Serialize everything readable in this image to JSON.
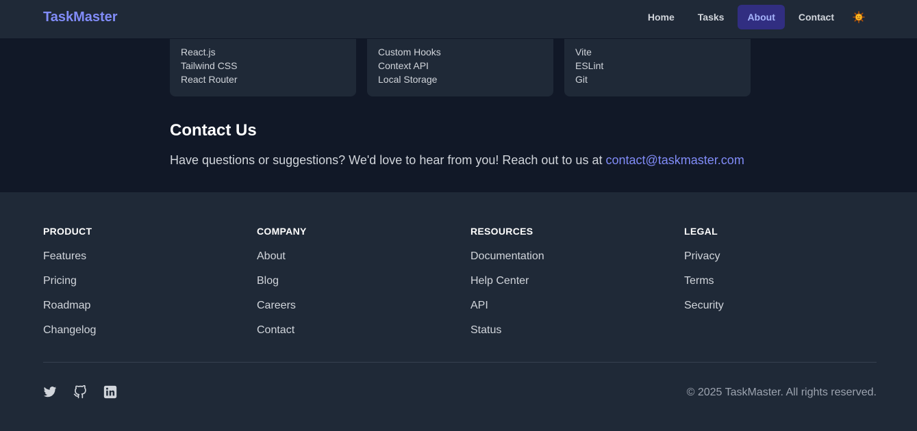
{
  "nav": {
    "brand": "TaskMaster",
    "links": [
      "Home",
      "Tasks",
      "About",
      "Contact"
    ],
    "active": "About",
    "theme_icon": "sun-emoji"
  },
  "tech": [
    {
      "items": [
        "React.js",
        "Tailwind CSS",
        "React Router"
      ]
    },
    {
      "items": [
        "Custom Hooks",
        "Context API",
        "Local Storage"
      ]
    },
    {
      "items": [
        "Vite",
        "ESLint",
        "Git"
      ]
    }
  ],
  "contact": {
    "title": "Contact Us",
    "text": "Have questions or suggestions? We'd love to hear from you! Reach out to us at ",
    "email": "contact@taskmaster.com"
  },
  "footer": {
    "columns": [
      {
        "heading": "PRODUCT",
        "links": [
          "Features",
          "Pricing",
          "Roadmap",
          "Changelog"
        ]
      },
      {
        "heading": "COMPANY",
        "links": [
          "About",
          "Blog",
          "Careers",
          "Contact"
        ]
      },
      {
        "heading": "RESOURCES",
        "links": [
          "Documentation",
          "Help Center",
          "API",
          "Status"
        ]
      },
      {
        "heading": "LEGAL",
        "links": [
          "Privacy",
          "Terms",
          "Security"
        ]
      }
    ],
    "social": [
      "twitter-icon",
      "github-icon",
      "linkedin-icon"
    ],
    "copyright": "© 2025 TaskMaster. All rights reserved."
  },
  "colors": {
    "accent": "#818cf8",
    "active_bg": "#312e81",
    "page_bg": "#111827",
    "panel_bg": "#1f2937"
  }
}
